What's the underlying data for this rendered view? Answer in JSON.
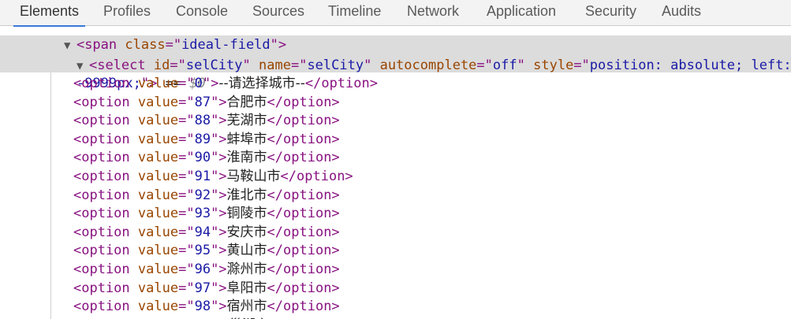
{
  "tabs": [
    {
      "label": "Elements",
      "active": true
    },
    {
      "label": "Profiles",
      "active": false
    },
    {
      "label": "Console",
      "active": false
    },
    {
      "label": "Sources",
      "active": false
    },
    {
      "label": "Timeline",
      "active": false
    },
    {
      "label": "Network",
      "active": false
    },
    {
      "label": "Application",
      "active": false
    },
    {
      "label": "Security",
      "active": false
    },
    {
      "label": "Audits",
      "active": false
    }
  ],
  "dom": {
    "parent": {
      "tag": "span",
      "attr_name": "class",
      "attr_value": "ideal-field"
    },
    "select": {
      "tag": "select",
      "attrs": [
        {
          "name": "id",
          "value": "selCity"
        },
        {
          "name": "name",
          "value": "selCity"
        },
        {
          "name": "autocomplete",
          "value": "off"
        },
        {
          "name": "style",
          "value": "position: absolute; left: -9999px;"
        }
      ],
      "style_line1": "position: absolute; left:",
      "style_line2": "-9999px;",
      "console_ref": "== $0"
    },
    "options": [
      {
        "value": "0",
        "text": "--请选择城市--"
      },
      {
        "value": "87",
        "text": "合肥市"
      },
      {
        "value": "88",
        "text": "芜湖市"
      },
      {
        "value": "89",
        "text": "蚌埠市"
      },
      {
        "value": "90",
        "text": "淮南市"
      },
      {
        "value": "91",
        "text": "马鞍山市"
      },
      {
        "value": "92",
        "text": "淮北市"
      },
      {
        "value": "93",
        "text": "铜陵市"
      },
      {
        "value": "94",
        "text": "安庆市"
      },
      {
        "value": "95",
        "text": "黄山市"
      },
      {
        "value": "96",
        "text": "滁州市"
      },
      {
        "value": "97",
        "text": "阜阳市"
      },
      {
        "value": "98",
        "text": "宿州市"
      },
      {
        "value": "",
        "text": "巢湖市"
      }
    ]
  },
  "colors": {
    "tag": "#881280",
    "attr_name": "#994500",
    "attr_value": "#1a1aa6",
    "selected_bg": "#dcdcdc",
    "active_tab_underline": "#3879d9"
  }
}
